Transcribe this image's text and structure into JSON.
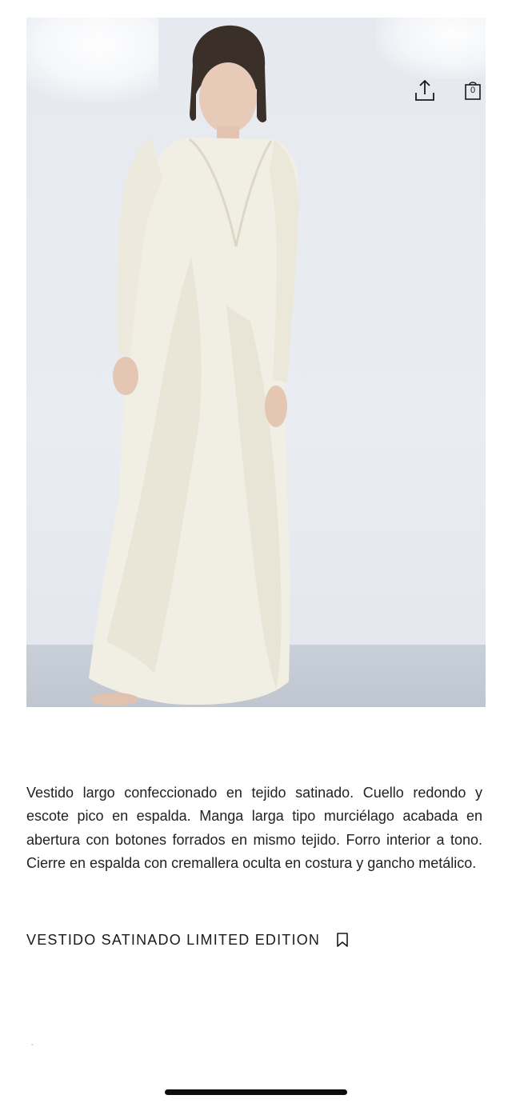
{
  "product": {
    "image_alt": "",
    "description": "Vestido largo confeccionado en tejido satinado. Cuello redondo y escote pico en espalda. Manga larga tipo murciélago acabada en abertura con botones forrados en mismo tejido. Forro interior a tono. Cierre en espalda con cremallera oculta en costura y gancho metálico.",
    "title": "VESTIDO SATINADO LIMITED EDITION"
  },
  "header": {
    "share_icon": "share-icon",
    "bag_icon": "shopping-bag-icon",
    "bag_count": "0"
  },
  "actions": {
    "bookmark_icon": "bookmark-icon"
  },
  "colors": {
    "background": "#ffffff",
    "text": "#1a1a1a",
    "image_backdrop": "#e8ecf1",
    "dress": "#f1eee3",
    "home_indicator": "#0d0d0d"
  }
}
